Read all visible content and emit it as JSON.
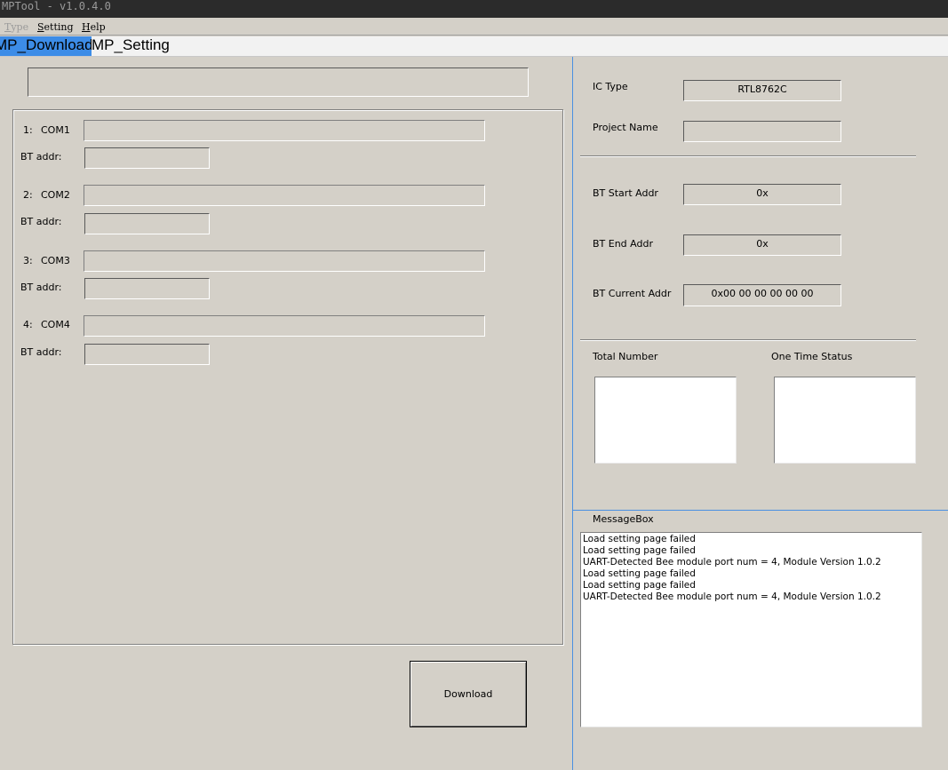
{
  "window": {
    "title": "MPTool - v1.0.4.0"
  },
  "menu": [
    {
      "label": "Type",
      "disabled": true
    },
    {
      "label": "Setting",
      "disabled": false
    },
    {
      "label": "Help",
      "disabled": false
    }
  ],
  "tabs": [
    {
      "label": "MP_Download",
      "active": true
    },
    {
      "label": "MP_Setting",
      "active": false
    }
  ],
  "download": {
    "top_field_value": "",
    "ports": [
      {
        "index": "1:",
        "name": "COM1",
        "bt_label": "BT addr:",
        "status": "",
        "bt_addr": ""
      },
      {
        "index": "2:",
        "name": "COM2",
        "bt_label": "BT addr:",
        "status": "",
        "bt_addr": ""
      },
      {
        "index": "3:",
        "name": "COM3",
        "bt_label": "BT addr:",
        "status": "",
        "bt_addr": ""
      },
      {
        "index": "4:",
        "name": "COM4",
        "bt_label": "BT addr:",
        "status": "",
        "bt_addr": ""
      }
    ],
    "download_button": "Download"
  },
  "info": {
    "ic_type_label": "IC Type",
    "ic_type_value": "RTL8762C",
    "project_name_label": "Project Name",
    "project_name_value": "",
    "bt_start_label": "BT Start Addr",
    "bt_start_value": "0x",
    "bt_end_label": "BT End Addr",
    "bt_end_value": "0x",
    "bt_current_label": "BT Current Addr",
    "bt_current_value": "0x00 00 00 00 00 00",
    "total_number_label": "Total Number",
    "one_time_status_label": "One Time Status"
  },
  "messagebox": {
    "label": "MessageBox",
    "lines": [
      "Load setting page failed",
      "Load setting page failed",
      "UART-Detected Bee module port num = 4, Module Version 1.0.2",
      "Load setting page failed",
      "Load setting page failed",
      "UART-Detected Bee module port num = 4, Module Version 1.0.2"
    ]
  }
}
